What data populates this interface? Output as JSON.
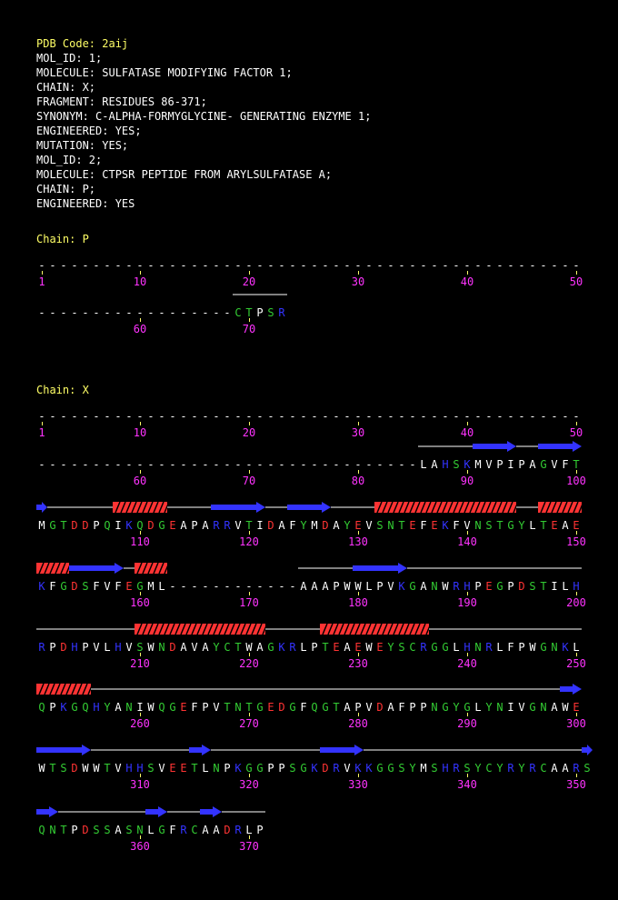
{
  "header": {
    "pdb_code": "PDB Code: 2aij",
    "lines": [
      "MOL_ID: 1;",
      "MOLECULE: SULFATASE MODIFYING FACTOR 1;",
      "CHAIN: X;",
      "FRAGMENT: RESIDUES 86-371;",
      "SYNONYM: C-ALPHA-FORMYGLYCINE- GENERATING ENZYME 1;",
      "ENGINEERED: YES;",
      "MUTATION: YES;",
      "MOL_ID: 2;",
      "MOLECULE: CTPSR PEPTIDE FROM ARYLSULFATASE A;",
      "CHAIN: P;",
      "ENGINEERED: YES"
    ]
  },
  "colors": {
    "acidic": "#ff3333",
    "basic": "#3333ff",
    "polar": "#33cc33",
    "hydrophobic": "#ffffff",
    "gap": "#ffffff",
    "number": "#ff33ff",
    "helix": "#ff3333",
    "strand": "#3333ff",
    "coil": "#ffffff",
    "label": "#ffff66"
  },
  "chains": [
    {
      "label": "Chain: P",
      "rows": [
        {
          "seq": "--------------------------------------------------",
          "start": 1
        },
        {
          "seq": "------------------CTPSR",
          "start": 51,
          "ss": [
            {
              "type": "coil",
              "from": 18,
              "to": 22
            }
          ]
        }
      ]
    },
    {
      "label": "Chain: X",
      "rows": [
        {
          "seq": "--------------------------------------------------",
          "start": 1
        },
        {
          "seq": "-----------------------------------LAHSKMVPIPAGVFT",
          "start": 51,
          "ss": [
            {
              "type": "coil",
              "from": 35,
              "to": 39
            },
            {
              "type": "strand",
              "from": 40,
              "to": 43
            },
            {
              "type": "coil",
              "from": 44,
              "to": 45
            },
            {
              "type": "strand",
              "from": 46,
              "to": 49
            }
          ]
        },
        {
          "seq": "MGTDDPQIKQDGEAPARRVTIDAFYMDAYEVSNTEFEKFVNSTGYLTEAE",
          "start": 101,
          "ss": [
            {
              "type": "strand",
              "from": 0,
              "to": 0
            },
            {
              "type": "coil",
              "from": 1,
              "to": 6
            },
            {
              "type": "helix",
              "from": 7,
              "to": 11
            },
            {
              "type": "coil",
              "from": 12,
              "to": 15
            },
            {
              "type": "strand",
              "from": 16,
              "to": 20
            },
            {
              "type": "coil",
              "from": 21,
              "to": 22
            },
            {
              "type": "strand",
              "from": 23,
              "to": 26
            },
            {
              "type": "coil",
              "from": 27,
              "to": 30
            },
            {
              "type": "helix",
              "from": 31,
              "to": 43
            },
            {
              "type": "coil",
              "from": 44,
              "to": 45
            },
            {
              "type": "helix",
              "from": 46,
              "to": 49
            }
          ]
        },
        {
          "seq": "KFGDSFVFEGML------------AAAPWWLPVKGANWRHPEGPDSTILH",
          "start": 151,
          "ss": [
            {
              "type": "helix",
              "from": 0,
              "to": 2
            },
            {
              "type": "strand",
              "from": 3,
              "to": 7
            },
            {
              "type": "coil",
              "from": 8,
              "to": 8
            },
            {
              "type": "helix",
              "from": 9,
              "to": 11
            },
            {
              "type": "coil",
              "from": 24,
              "to": 28
            },
            {
              "type": "strand",
              "from": 29,
              "to": 33
            },
            {
              "type": "coil",
              "from": 34,
              "to": 49
            }
          ]
        },
        {
          "seq": "RPDHPVLHVSWNDAVAYCTWAGKRLPTEAEWEYSCRGGLHNRLFPWGNKL",
          "start": 201,
          "ss": [
            {
              "type": "coil",
              "from": 0,
              "to": 8
            },
            {
              "type": "helix",
              "from": 9,
              "to": 20
            },
            {
              "type": "coil",
              "from": 21,
              "to": 25
            },
            {
              "type": "helix",
              "from": 26,
              "to": 35
            },
            {
              "type": "coil",
              "from": 36,
              "to": 49
            }
          ]
        },
        {
          "seq": "QPKGQHYANIWQGEFPVTNTGEDGFQGTAPVDAFPPNGYGLYNIVGNAWE",
          "start": 251,
          "ss": [
            {
              "type": "helix",
              "from": 0,
              "to": 4
            },
            {
              "type": "coil",
              "from": 5,
              "to": 47
            },
            {
              "type": "strand",
              "from": 48,
              "to": 49
            }
          ]
        },
        {
          "seq": "WTSDWWTVHHSVEETLNPKGGPPSGKDRVKKGGSYMSHRSYCYRYRCAARS",
          "start": 301,
          "ss": [
            {
              "type": "strand",
              "from": 0,
              "to": 4
            },
            {
              "type": "coil",
              "from": 5,
              "to": 13
            },
            {
              "type": "strand",
              "from": 14,
              "to": 15
            },
            {
              "type": "coil",
              "from": 16,
              "to": 25
            },
            {
              "type": "strand",
              "from": 26,
              "to": 29
            },
            {
              "type": "coil",
              "from": 30,
              "to": 49
            },
            {
              "type": "strand",
              "from": 50,
              "to": 50
            }
          ]
        },
        {
          "seq": "QNTPDSSASNLGFRCAADRLP",
          "start": 351,
          "ss": [
            {
              "type": "strand",
              "from": 0,
              "to": 1
            },
            {
              "type": "coil",
              "from": 2,
              "to": 9
            },
            {
              "type": "strand",
              "from": 10,
              "to": 11
            },
            {
              "type": "coil",
              "from": 12,
              "to": 14
            },
            {
              "type": "strand",
              "from": 15,
              "to": 16
            },
            {
              "type": "coil",
              "from": 17,
              "to": 20
            }
          ]
        }
      ]
    }
  ]
}
